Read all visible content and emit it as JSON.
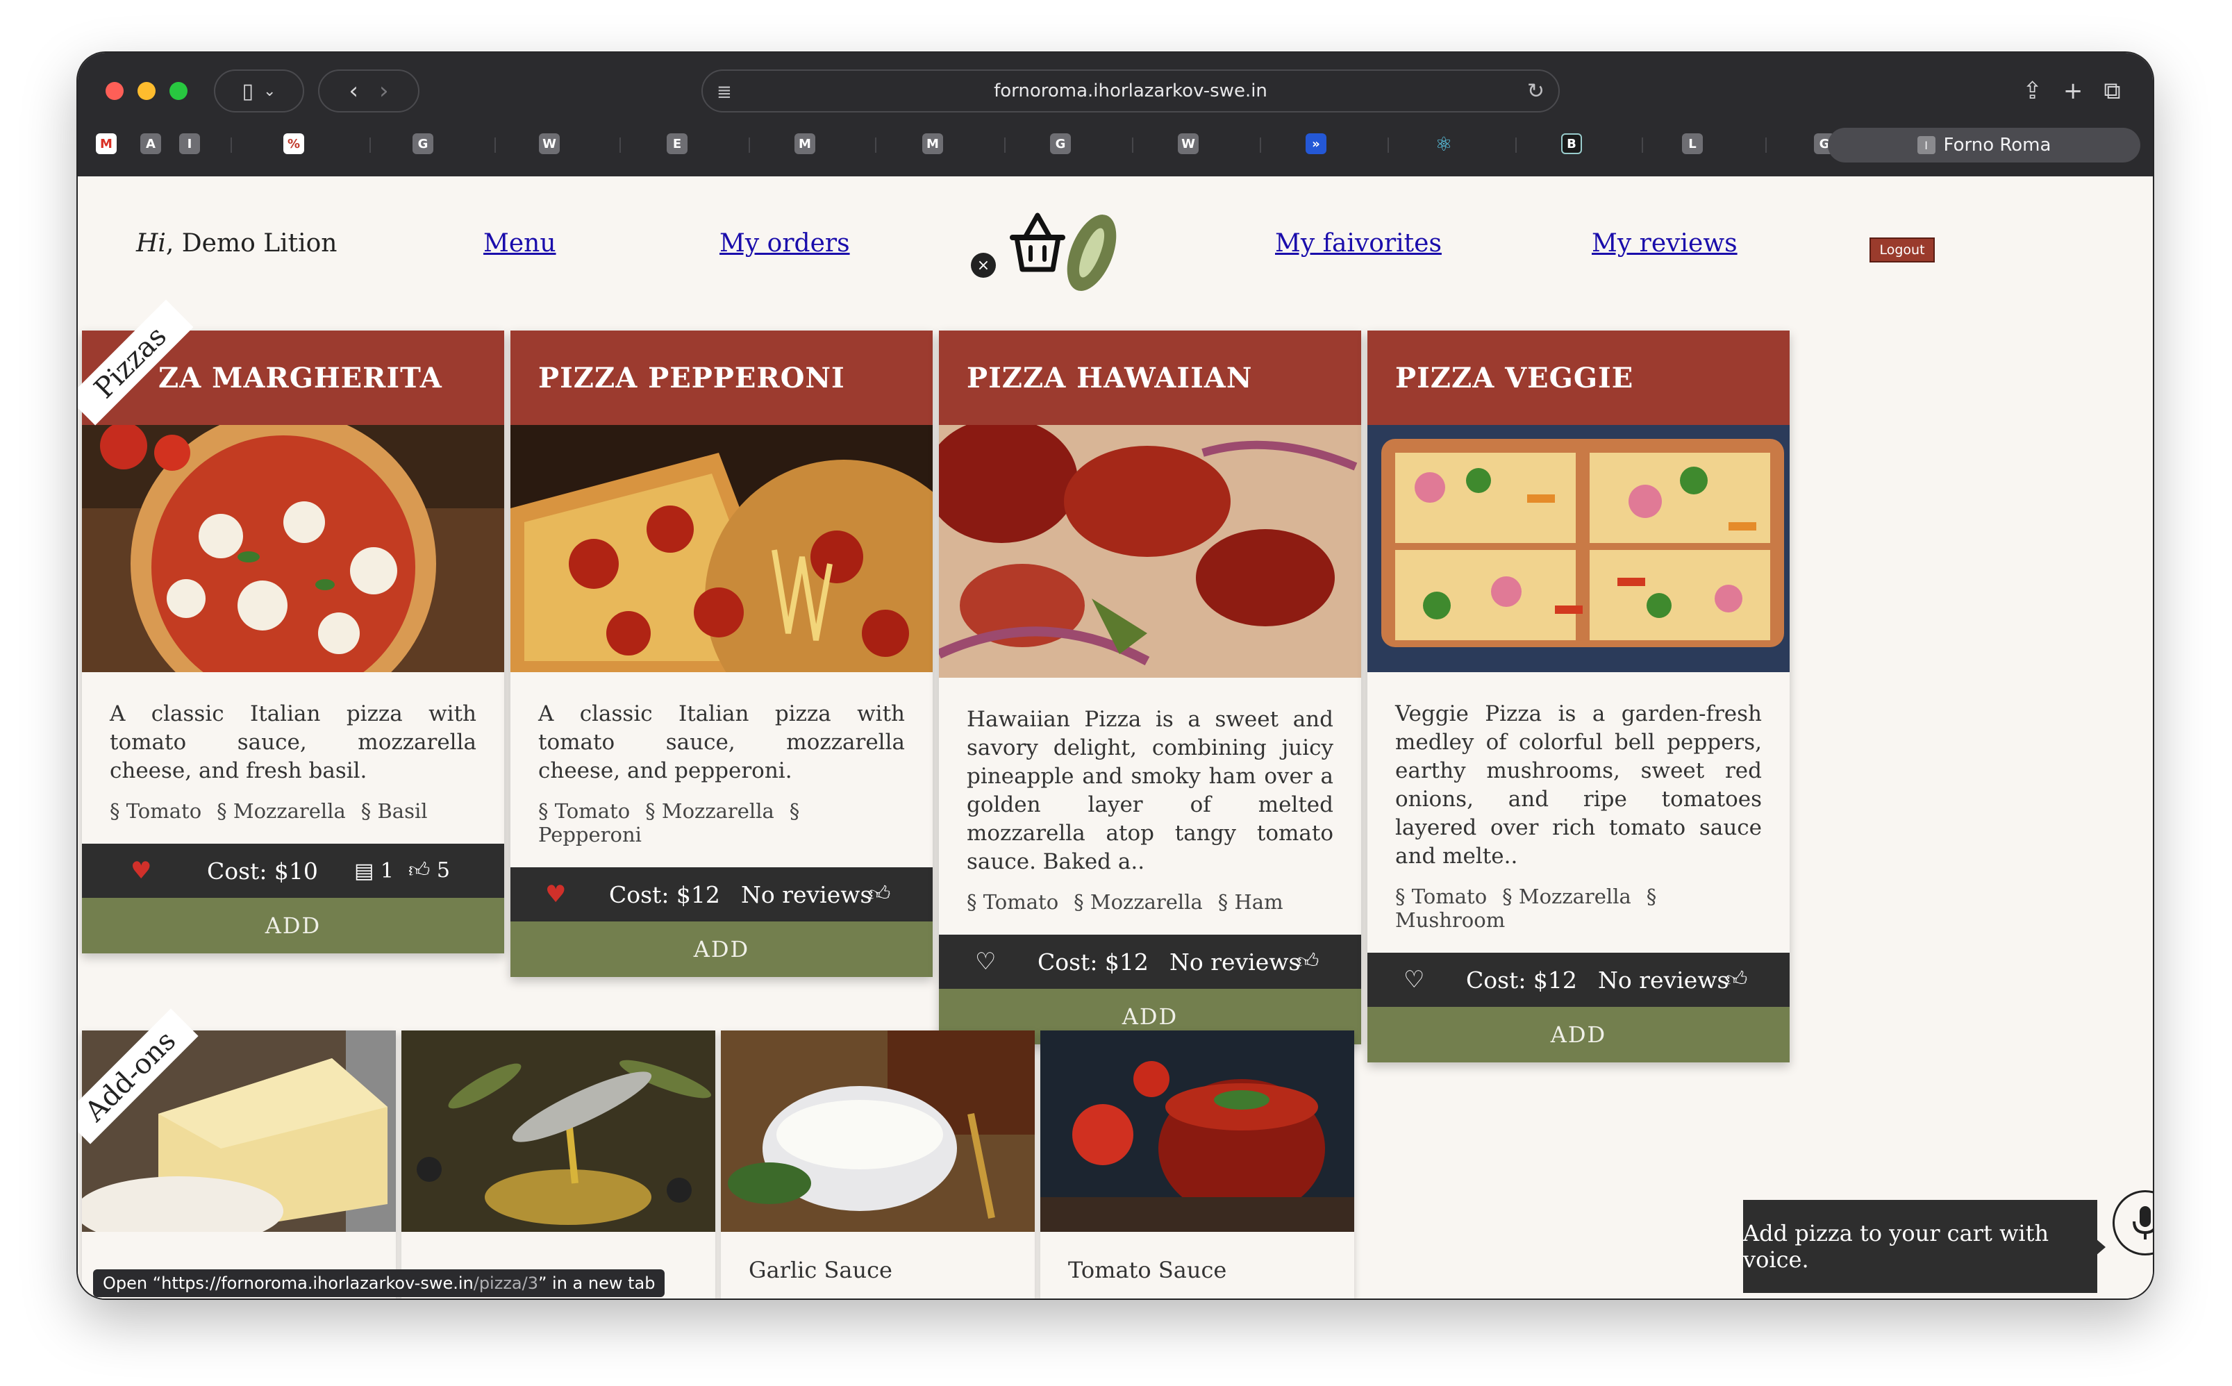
{
  "browser": {
    "url": "fornoroma.ihorlazarkov-swe.in",
    "active_tab": "Forno Roma",
    "active_tab_icon": "I",
    "favorites": [
      "M",
      "A",
      "I",
      "%",
      "G",
      "W",
      "E",
      "M",
      "M",
      "G",
      "W",
      "»",
      "⚛",
      "B",
      "L",
      "G"
    ]
  },
  "header": {
    "greeting_prefix": "Hi",
    "greeting_name": ", Demo Lition",
    "nav": {
      "menu": "Menu",
      "orders": "My orders",
      "favorites": "My faivorites",
      "reviews": "My reviews"
    },
    "logout": "Logout",
    "cart_remove": "×"
  },
  "sections": {
    "pizzas": "Pizzas",
    "addons": "Add-ons"
  },
  "pizzas": [
    {
      "title": "ZA MARGHERITA",
      "description": "A classic Italian pizza with tomato sauce, mozzarella cheese, and fresh basil.",
      "ingredients": [
        "§ Tomato",
        "§ Mozzarella",
        "§ Basil"
      ],
      "cost": "Cost: $10",
      "reviews_count": "1",
      "likes": "5",
      "add": "ADD",
      "favorited": true
    },
    {
      "title": "PIZZA PEPPERONI",
      "description": "A classic Italian pizza with tomato sauce, mozzarella cheese, and pepperoni.",
      "ingredients": [
        "§ Tomato",
        "§ Mozzarella",
        "§ Pepperoni"
      ],
      "cost": "Cost: $12",
      "reviews": "No reviews",
      "add": "ADD",
      "favorited": true
    },
    {
      "title": "PIZZA HAWAIIAN",
      "description": "Hawaiian Pizza is a sweet and savory delight, combining juicy pineapple and smoky ham over a golden layer of melted mozzarella atop tangy tomato sauce. Baked a..",
      "ingredients": [
        "§ Tomato",
        "§ Mozzarella",
        "§ Ham"
      ],
      "cost": "Cost: $12",
      "reviews": "No reviews",
      "add": "ADD",
      "favorited": false
    },
    {
      "title": "PIZZA VEGGIE",
      "description": "Veggie Pizza is a garden-fresh medley of colorful bell peppers, earthy mushrooms, sweet red onions, and ripe tomatoes layered over rich tomato sauce and melte..",
      "ingredients": [
        "§ Tomato",
        "§ Mozzarella",
        "§ Mushroom"
      ],
      "cost": "Cost: $12",
      "reviews": "No reviews",
      "add": "ADD",
      "favorited": false
    }
  ],
  "addons": [
    {
      "name": ""
    },
    {
      "name": ""
    },
    {
      "name": "Garlic Sauce"
    },
    {
      "name": "Tomato Sauce"
    }
  ],
  "voice": {
    "tooltip": "Add pizza to your cart with voice."
  },
  "status_bar": {
    "prefix": "Open “https://fornoroma.ihorlazarkov-swe.in",
    "path": "/pizza/3",
    "suffix": "” in a new tab"
  },
  "colors": {
    "card_header": "#9c3b2f",
    "add_button": "#737f4e",
    "footer_bar": "#2e2e2e",
    "heart": "#d0302a",
    "link": "#1a0dab"
  }
}
